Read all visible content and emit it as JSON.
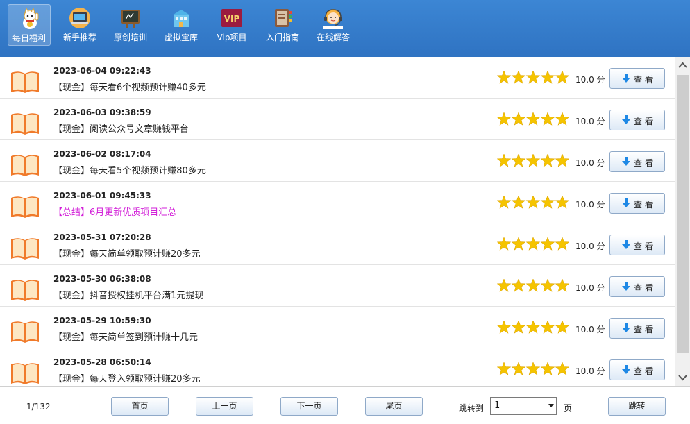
{
  "nav": {
    "items": [
      {
        "label": "每日福利",
        "icon": "lucky-cat-icon",
        "active": true
      },
      {
        "label": "新手推荐",
        "icon": "laptop-icon",
        "active": false
      },
      {
        "label": "原创培训",
        "icon": "chalkboard-icon",
        "active": false
      },
      {
        "label": "虚拟宝库",
        "icon": "building-icon",
        "active": false
      },
      {
        "label": "Vip项目",
        "icon": "vip-badge-icon",
        "active": false
      },
      {
        "label": "入门指南",
        "icon": "guide-book-icon",
        "active": false
      },
      {
        "label": "在线解答",
        "icon": "support-agent-icon",
        "active": false
      }
    ]
  },
  "list": {
    "rows": [
      {
        "date": "2023-06-04 09:22:43",
        "title": "【现金】每天看6个视频预计赚40多元",
        "rating": 5,
        "score": "10.0 分",
        "button": "查 看",
        "highlight": false
      },
      {
        "date": "2023-06-03 09:38:59",
        "title": "【现金】阅读公众号文章赚钱平台",
        "rating": 5,
        "score": "10.0 分",
        "button": "查 看",
        "highlight": false
      },
      {
        "date": "2023-06-02 08:17:04",
        "title": "【现金】每天看5个视频预计赚80多元",
        "rating": 5,
        "score": "10.0 分",
        "button": "查 看",
        "highlight": false
      },
      {
        "date": "2023-06-01 09:45:33",
        "title": "【总结】6月更新优质项目汇总",
        "rating": 5,
        "score": "10.0 分",
        "button": "查 看",
        "highlight": true
      },
      {
        "date": "2023-05-31 07:20:28",
        "title": "【现金】每天简单领取预计赚20多元",
        "rating": 5,
        "score": "10.0 分",
        "button": "查 看",
        "highlight": false
      },
      {
        "date": "2023-05-30 06:38:08",
        "title": "【现金】抖音授权挂机平台满1元提现",
        "rating": 5,
        "score": "10.0 分",
        "button": "查 看",
        "highlight": false
      },
      {
        "date": "2023-05-29 10:59:30",
        "title": "【现金】每天简单签到预计赚十几元",
        "rating": 5,
        "score": "10.0 分",
        "button": "查 看",
        "highlight": false
      },
      {
        "date": "2023-05-28 06:50:14",
        "title": "【现金】每天登入领取预计赚20多元",
        "rating": 5,
        "score": "10.0 分",
        "button": "查 看",
        "highlight": false
      }
    ]
  },
  "pager": {
    "info": "1/132",
    "first": "首页",
    "prev": "上一页",
    "next": "下一页",
    "last": "尾页",
    "jump_label": "跳转到",
    "jump_value": "1",
    "unit": "页",
    "go": "跳转"
  },
  "colors": {
    "topbar": "#3579c9",
    "star": "#f5c400",
    "highlight_title": "#d21fd8",
    "download_arrow": "#1e88e5"
  }
}
